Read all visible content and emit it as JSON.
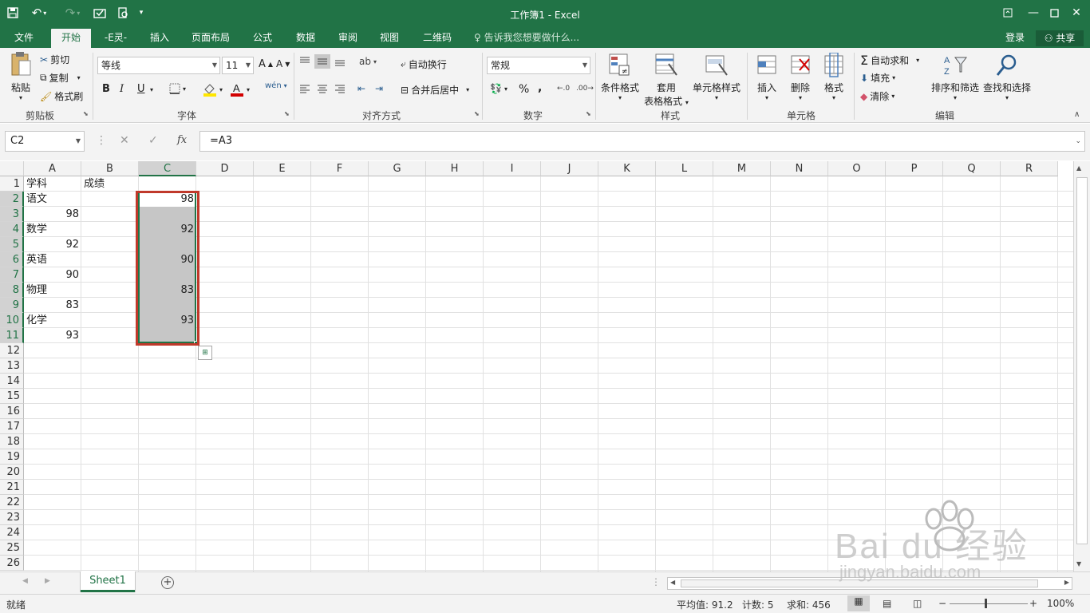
{
  "window": {
    "title": "工作簿1 - Excel"
  },
  "tabs": [
    {
      "label": "文件"
    },
    {
      "label": "开始"
    },
    {
      "label": "-E灵-"
    },
    {
      "label": "插入"
    },
    {
      "label": "页面布局"
    },
    {
      "label": "公式"
    },
    {
      "label": "数据"
    },
    {
      "label": "审阅"
    },
    {
      "label": "视图"
    },
    {
      "label": "二维码"
    }
  ],
  "tellme": "告诉我您想要做什么...",
  "account": {
    "login": "登录",
    "share": "共享"
  },
  "ribbon": {
    "clipboard": {
      "paste": "粘贴",
      "cut": "剪切",
      "copy": "复制",
      "format_painter": "格式刷",
      "label": "剪贴板"
    },
    "font": {
      "name": "等线",
      "size": "11",
      "bold": "B",
      "italic": "I",
      "underline": "U",
      "label": "字体"
    },
    "alignment": {
      "wrap": "自动换行",
      "merge": "合并后居中",
      "label": "对齐方式"
    },
    "number": {
      "format": "常规",
      "percent": "%",
      "comma": ",",
      "label": "数字"
    },
    "styles": {
      "conditional": "条件格式",
      "table_line1": "套用",
      "table_line2": "表格格式",
      "cell_styles": "单元格样式",
      "label": "样式"
    },
    "cells": {
      "insert": "插入",
      "delete": "删除",
      "format": "格式",
      "label": "单元格"
    },
    "editing": {
      "autosum": "自动求和",
      "fill": "填充",
      "clear": "清除",
      "sort": "排序和筛选",
      "find": "查找和选择",
      "label": "编辑"
    }
  },
  "formula_bar": {
    "name_box": "C2",
    "formula": "=A3",
    "fx": "fx"
  },
  "columns": [
    "A",
    "B",
    "C",
    "D",
    "E",
    "F",
    "G",
    "H",
    "I",
    "J",
    "K",
    "L",
    "M",
    "N",
    "O",
    "P",
    "Q",
    "R"
  ],
  "selected_column": "C",
  "rows": [
    "1",
    "2",
    "3",
    "4",
    "5",
    "6",
    "7",
    "8",
    "9",
    "10",
    "11",
    "12",
    "13",
    "14",
    "15",
    "16",
    "17",
    "18",
    "19",
    "20",
    "21",
    "22",
    "23",
    "24",
    "25",
    "26"
  ],
  "cells": {
    "A1": "学科",
    "B1": "成绩",
    "A2": "语文",
    "A3": "98",
    "A4": "数学",
    "A5": "92",
    "A6": "英语",
    "A7": "90",
    "A8": "物理",
    "A9": "83",
    "A10": "化学",
    "A11": "93",
    "C2": "98",
    "C4": "92",
    "C6": "90",
    "C8": "83",
    "C10": "93"
  },
  "sheet": {
    "name": "Sheet1"
  },
  "status": {
    "ready": "就绪",
    "average": "平均值: 91.2",
    "count": "计数: 5",
    "sum": "求和: 456",
    "zoom": "100%"
  },
  "colors": {
    "accent": "#217346",
    "selection_fill": "#c6c6c6",
    "annotation": "#c0392b"
  },
  "watermark": {
    "brand": "Bai du 经验",
    "url": "jingyan.baidu.com"
  }
}
